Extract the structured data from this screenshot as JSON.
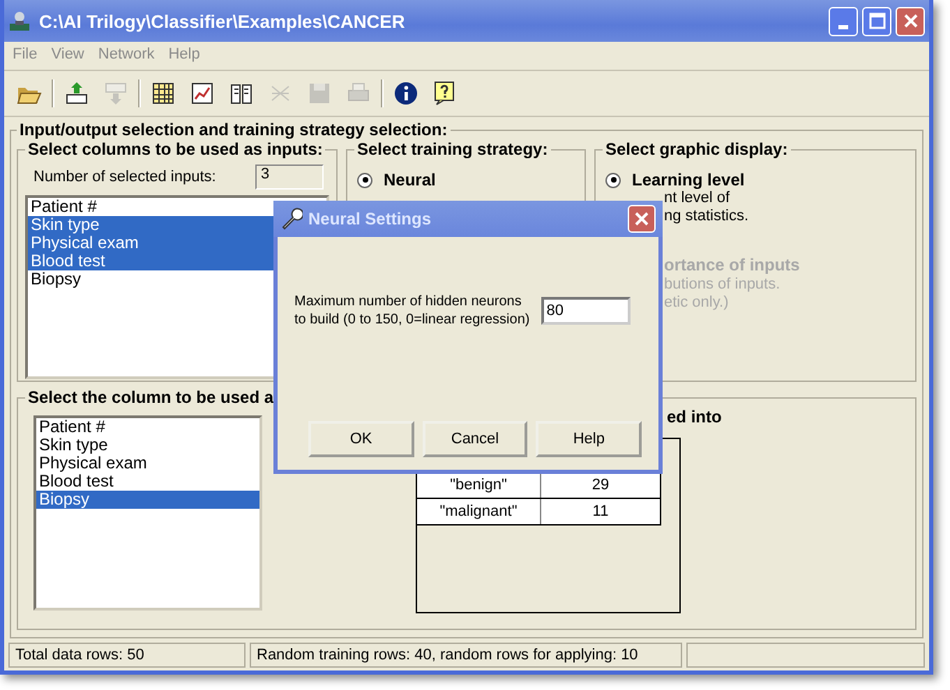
{
  "window": {
    "title": "C:\\AI Trilogy\\Classifier\\Examples\\CANCER"
  },
  "menu": [
    "File",
    "View",
    "Network",
    "Help"
  ],
  "toolbar": [
    {
      "kind": "open",
      "disabled": false
    },
    {
      "kind": "import",
      "disabled": false
    },
    {
      "kind": "export",
      "disabled": true
    },
    {
      "kind": "grid",
      "disabled": false
    },
    {
      "kind": "chart",
      "disabled": false
    },
    {
      "kind": "book",
      "disabled": false
    },
    {
      "kind": "network",
      "disabled": true
    },
    {
      "kind": "save",
      "disabled": true
    },
    {
      "kind": "print",
      "disabled": true
    },
    {
      "kind": "info",
      "disabled": false
    },
    {
      "kind": "help",
      "disabled": false
    }
  ],
  "main_group": {
    "title": "Input/output selection and training strategy selection:"
  },
  "inputs_group": {
    "title": "Select columns to be used as inputs:",
    "count_label": "Number of selected inputs:",
    "count": "3",
    "items": [
      {
        "label": "Patient #",
        "selected": false
      },
      {
        "label": "Skin type",
        "selected": true
      },
      {
        "label": "Physical exam",
        "selected": true
      },
      {
        "label": "Blood test",
        "selected": true
      },
      {
        "label": "Biopsy",
        "selected": false
      }
    ]
  },
  "strategy_group": {
    "title": "Select training strategy:",
    "options": [
      {
        "label": "Neural",
        "selected": true
      }
    ]
  },
  "display_group": {
    "title": "Select graphic display:",
    "options": [
      {
        "label": "Learning level",
        "selected": true,
        "disabled": false,
        "description": [
          "nt level of",
          "ng statistics."
        ]
      },
      {
        "label": "ortance of inputs",
        "disabled": true,
        "description": [
          "butions of inputs.",
          "etic only.)"
        ]
      }
    ]
  },
  "output_group": {
    "title": "Select the column to be used a",
    "items": [
      {
        "label": "Patient #",
        "selected": false
      },
      {
        "label": "Skin type",
        "selected": false
      },
      {
        "label": "Physical exam",
        "selected": false
      },
      {
        "label": "Blood test",
        "selected": false
      },
      {
        "label": "Biopsy",
        "selected": true
      }
    ]
  },
  "split_group": {
    "title": "ed into",
    "rows": [
      {
        "column_1": "\"benign\"",
        "column_2": "29"
      },
      {
        "column_1": "\"malignant\"",
        "column_2": "11"
      }
    ]
  },
  "status_bar": [
    "Total data rows: 50",
    "Random training rows: 40, random rows for applying: 10"
  ],
  "dialog": {
    "title": "Neural Settings",
    "label": "Maximum number of hidden neurons\nto build (0 to 150, 0=linear regression)",
    "value": "80",
    "buttons": [
      "OK",
      "Cancel",
      "Help"
    ]
  }
}
